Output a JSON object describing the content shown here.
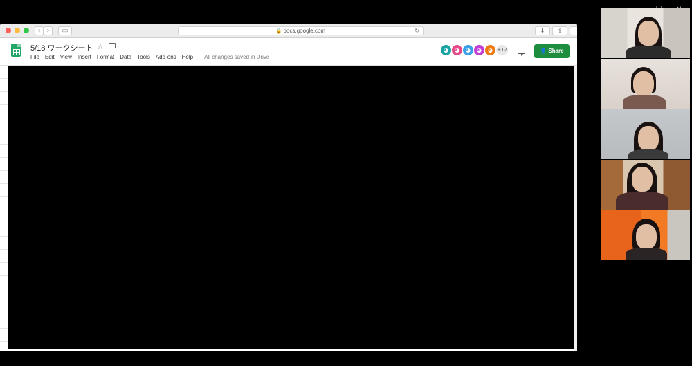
{
  "browser": {
    "url": "docs.google.com",
    "nav_back": "‹",
    "nav_forward": "›"
  },
  "sheet": {
    "title": "5/18 ワークシート",
    "menu": [
      "File",
      "Edit",
      "View",
      "Insert",
      "Format",
      "Data",
      "Tools",
      "Add-ons",
      "Help"
    ],
    "save_status": "All changes saved in Drive",
    "collaborators": [
      {
        "color": "#1aa3a3",
        "glyph": "◕"
      },
      {
        "color": "#e64a8a",
        "glyph": "◕"
      },
      {
        "color": "#3aa0e8",
        "glyph": "◕"
      },
      {
        "color": "#c23fd6",
        "glyph": "◕"
      },
      {
        "color": "#f07a12",
        "glyph": "◕"
      }
    ],
    "collaborators_more": "+12",
    "share_label": "Share",
    "brand_color": "#1e8e3e"
  },
  "participants": {
    "count": 5
  },
  "window_controls": {
    "minimize": "—",
    "maximize": "❐",
    "close": "✕"
  }
}
